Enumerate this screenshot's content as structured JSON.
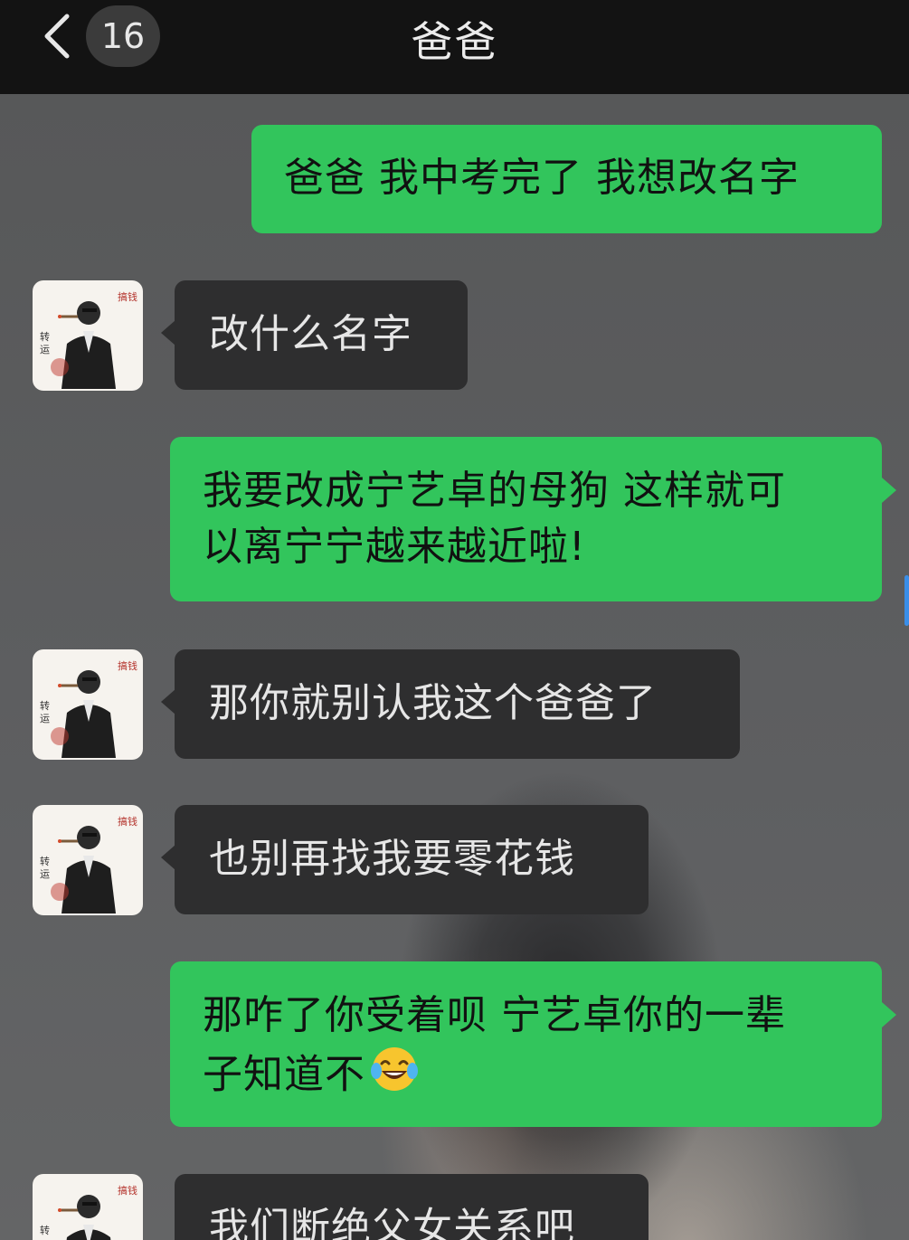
{
  "header": {
    "unread_count": "16",
    "title": "爸爸",
    "back_icon": "chevron-left-icon"
  },
  "messages": [
    {
      "side": "me",
      "text": "爸爸 我中考完了 我想改名字"
    },
    {
      "side": "them",
      "text": "改什么名字"
    },
    {
      "side": "me",
      "lines": [
        "我要改成宁艺卓的母狗 这样就可",
        "以离宁宁越来越近啦!"
      ]
    },
    {
      "side": "them",
      "text": "那你就别认我这个爸爸了"
    },
    {
      "side": "them",
      "text": "也别再找我要零花钱"
    },
    {
      "side": "me",
      "lines": [
        "那咋了你受着呗 宁艺卓你的一辈",
        "子知道不"
      ],
      "emoji": "tears-of-joy-emoji"
    },
    {
      "side": "them",
      "text": "我们断绝父女关系吧"
    }
  ],
  "colors": {
    "my_bubble": "#32c55c",
    "their_bubble": "#2e2e2f",
    "header_bg": "#131313"
  }
}
